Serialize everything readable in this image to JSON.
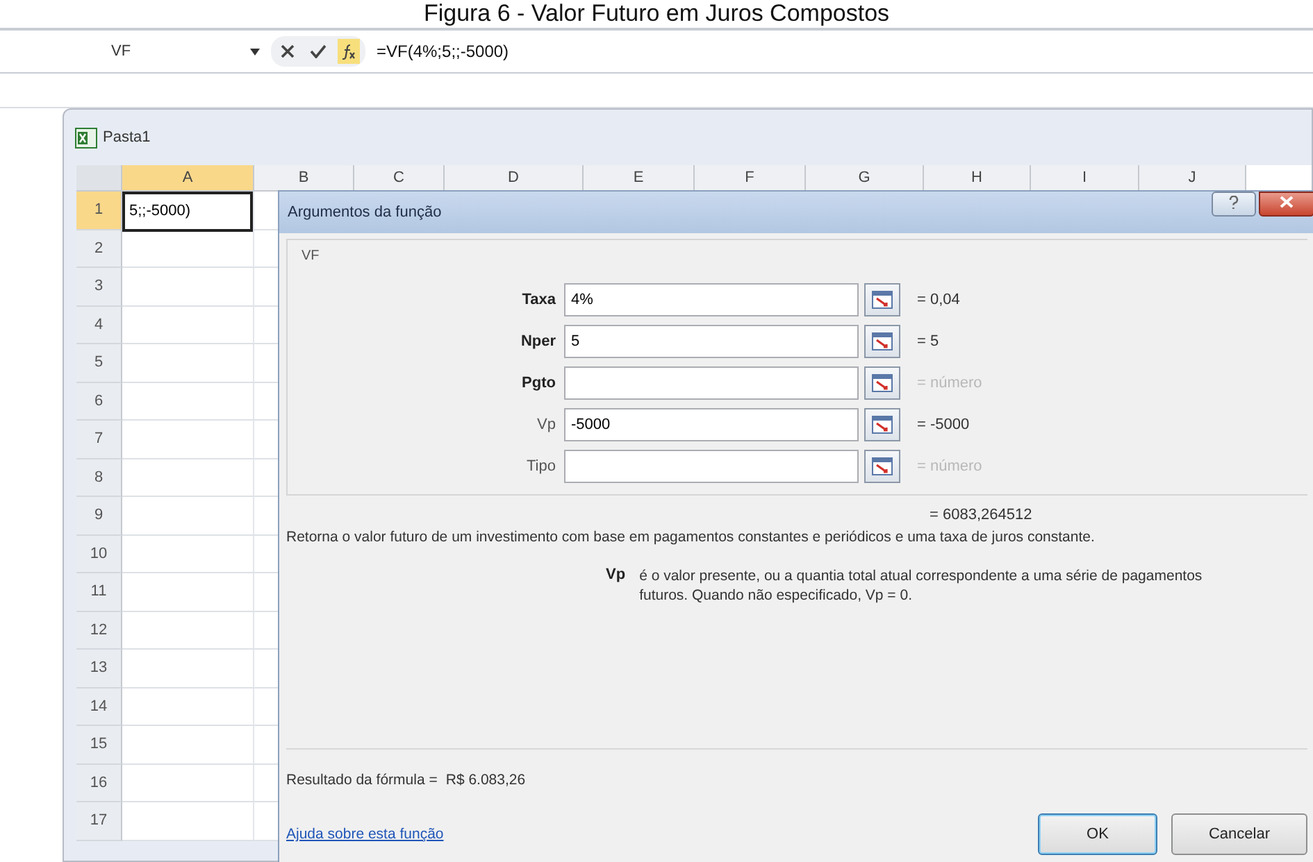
{
  "caption": "Figura 6 - Valor Futuro em Juros Compostos",
  "formula_bar": {
    "name_box": "VF",
    "formula": "=VF(4%;5;;-5000)"
  },
  "workbook": {
    "title": "Pasta1",
    "columns": [
      {
        "label": "A",
        "selected": true
      },
      {
        "label": "B",
        "selected": false
      },
      {
        "label": "C",
        "selected": false
      },
      {
        "label": "D",
        "selected": false
      },
      {
        "label": "E",
        "selected": false
      },
      {
        "label": "F",
        "selected": false
      },
      {
        "label": "G",
        "selected": false
      },
      {
        "label": "H",
        "selected": false
      },
      {
        "label": "I",
        "selected": false
      },
      {
        "label": "J",
        "selected": false
      }
    ],
    "rows": [
      {
        "label": "1",
        "selected": true,
        "cell_a": "5;;-5000)"
      },
      {
        "label": "2",
        "selected": false
      },
      {
        "label": "3",
        "selected": false
      },
      {
        "label": "4",
        "selected": false
      },
      {
        "label": "5",
        "selected": false
      },
      {
        "label": "6",
        "selected": false
      },
      {
        "label": "7",
        "selected": false
      },
      {
        "label": "8",
        "selected": false
      },
      {
        "label": "9",
        "selected": false
      },
      {
        "label": "10",
        "selected": false
      },
      {
        "label": "11",
        "selected": false
      },
      {
        "label": "12",
        "selected": false
      },
      {
        "label": "13",
        "selected": false
      },
      {
        "label": "14",
        "selected": false
      },
      {
        "label": "15",
        "selected": false
      },
      {
        "label": "16",
        "selected": false
      },
      {
        "label": "17",
        "selected": false
      }
    ]
  },
  "dialog": {
    "title": "Argumentos da função",
    "function_name": "VF",
    "arguments": [
      {
        "name": "Taxa",
        "required": true,
        "value": "4%",
        "result": "= 0,04",
        "result_muted": false
      },
      {
        "name": "Nper",
        "required": true,
        "value": "5",
        "result": "= 5",
        "result_muted": false
      },
      {
        "name": "Pgto",
        "required": true,
        "result": "= número",
        "result_muted": true
      },
      {
        "name": "Vp",
        "required": false,
        "value": "-5000",
        "result": "= -5000",
        "result_muted": false
      },
      {
        "name": "Tipo",
        "required": false,
        "result": "= número",
        "result_muted": true
      }
    ],
    "result": "= 6083,264512",
    "description": "Retorna o valor futuro de um investimento com base em pagamentos constantes e periódicos e uma taxa de juros constante.",
    "arg_help": {
      "name": "Vp",
      "text": "é o valor presente, ou a quantia total atual correspondente a uma série de pagamentos futuros. Quando não especificado, Vp = 0."
    },
    "formula_result": {
      "label": "Resultado da fórmula =",
      "value": "R$ 6.083,26"
    },
    "help_link": "Ajuda sobre esta função",
    "buttons": [
      {
        "label": "OK",
        "default": true
      },
      {
        "label": "Cancelar",
        "default": false
      }
    ]
  }
}
